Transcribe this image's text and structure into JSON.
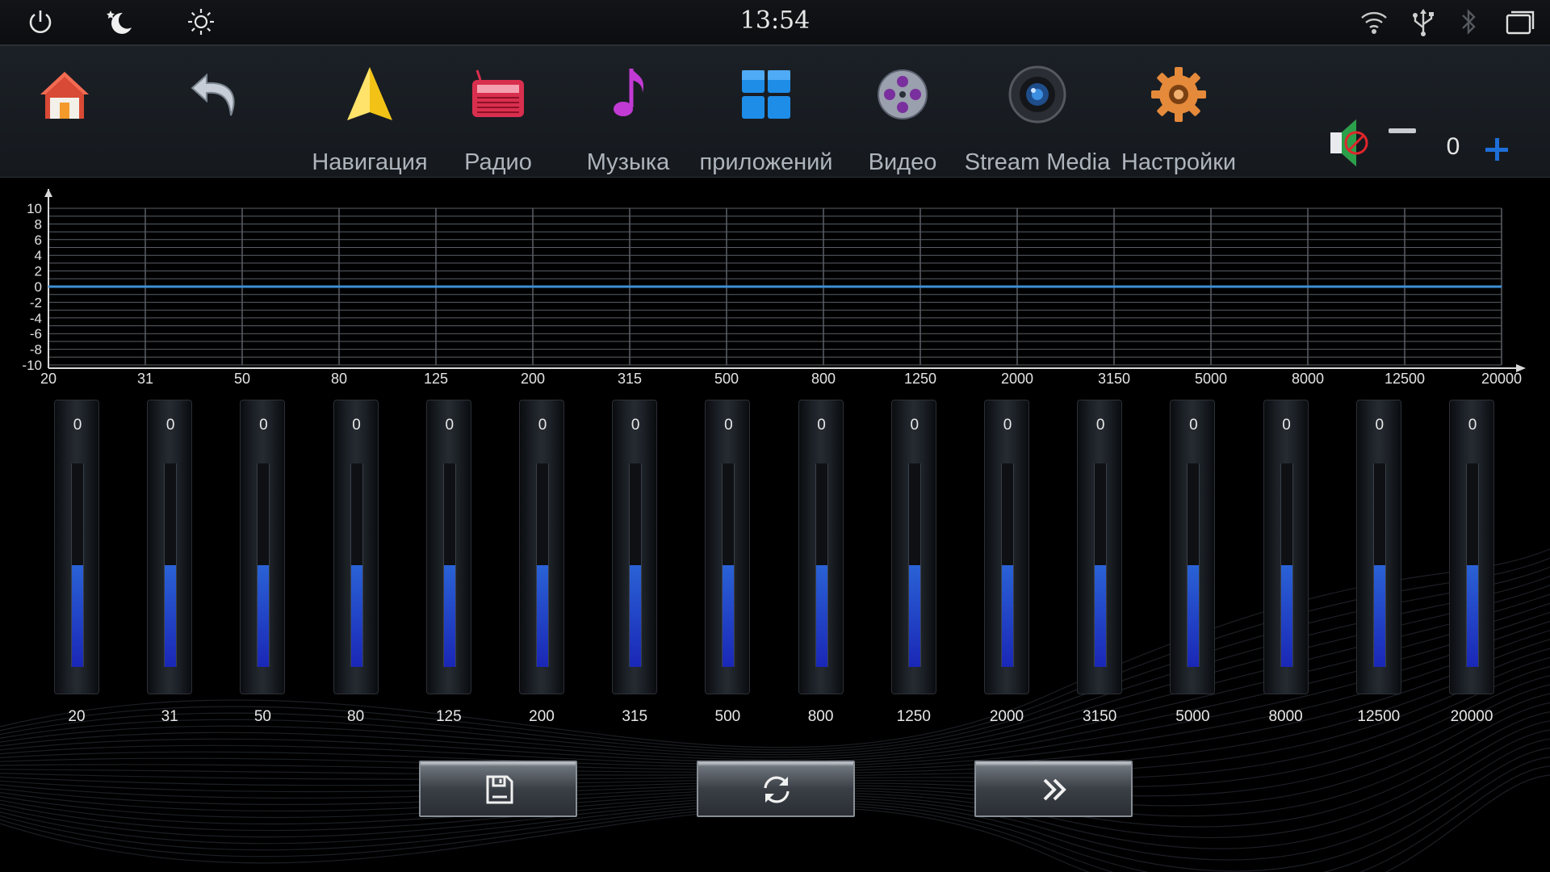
{
  "status_bar": {
    "time": "13:54",
    "left_icons": [
      "power-icon",
      "night-mode-icon",
      "brightness-icon"
    ],
    "right_icons": [
      "wifi-icon",
      "usb-icon",
      "bluetooth-icon",
      "recent-apps-icon"
    ]
  },
  "app_bar": {
    "items": [
      {
        "icon": "home-icon",
        "label": ""
      },
      {
        "icon": "back-icon",
        "label": ""
      },
      {
        "icon": "navigation-icon",
        "label": "Навигация"
      },
      {
        "icon": "radio-icon",
        "label": "Радио"
      },
      {
        "icon": "music-icon",
        "label": "Музыка"
      },
      {
        "icon": "apps-icon",
        "label": "приложений"
      },
      {
        "icon": "video-icon",
        "label": "Видео"
      },
      {
        "icon": "stream-media-icon",
        "label": "Stream Media"
      },
      {
        "icon": "settings-icon",
        "label": "Настройки"
      }
    ],
    "volume": {
      "value": "0",
      "minus": "−",
      "plus": "+"
    }
  },
  "graph": {
    "y_ticks": [
      "10",
      "8",
      "6",
      "4",
      "2",
      "0",
      "-2",
      "-4",
      "-6",
      "-8",
      "-10"
    ],
    "x_ticks": [
      "20",
      "31",
      "50",
      "80",
      "125",
      "200",
      "315",
      "500",
      "800",
      "1250",
      "2000",
      "3150",
      "5000",
      "8000",
      "12500",
      "20000"
    ],
    "curve_color": "#3d8fd6"
  },
  "chart_data": {
    "type": "line",
    "x": [
      "20",
      "31",
      "50",
      "80",
      "125",
      "200",
      "315",
      "500",
      "800",
      "1250",
      "2000",
      "3150",
      "5000",
      "8000",
      "12500",
      "20000"
    ],
    "series": [
      {
        "values": [
          0,
          0,
          0,
          0,
          0,
          0,
          0,
          0,
          0,
          0,
          0,
          0,
          0,
          0,
          0,
          0
        ]
      }
    ],
    "ylim": [
      -10,
      10
    ],
    "grid": true
  },
  "equalizer": {
    "bands": [
      {
        "freq": "20",
        "value": "0"
      },
      {
        "freq": "31",
        "value": "0"
      },
      {
        "freq": "50",
        "value": "0"
      },
      {
        "freq": "80",
        "value": "0"
      },
      {
        "freq": "125",
        "value": "0"
      },
      {
        "freq": "200",
        "value": "0"
      },
      {
        "freq": "315",
        "value": "0"
      },
      {
        "freq": "500",
        "value": "0"
      },
      {
        "freq": "800",
        "value": "0"
      },
      {
        "freq": "1250",
        "value": "0"
      },
      {
        "freq": "2000",
        "value": "0"
      },
      {
        "freq": "3150",
        "value": "0"
      },
      {
        "freq": "5000",
        "value": "0"
      },
      {
        "freq": "8000",
        "value": "0"
      },
      {
        "freq": "12500",
        "value": "0"
      },
      {
        "freq": "20000",
        "value": "0"
      }
    ],
    "range": [
      -10,
      10
    ],
    "fill_color": "#2344c8"
  },
  "buttons": [
    {
      "icon": "save-icon"
    },
    {
      "icon": "reset-icon"
    },
    {
      "icon": "next-preset-icon"
    }
  ]
}
